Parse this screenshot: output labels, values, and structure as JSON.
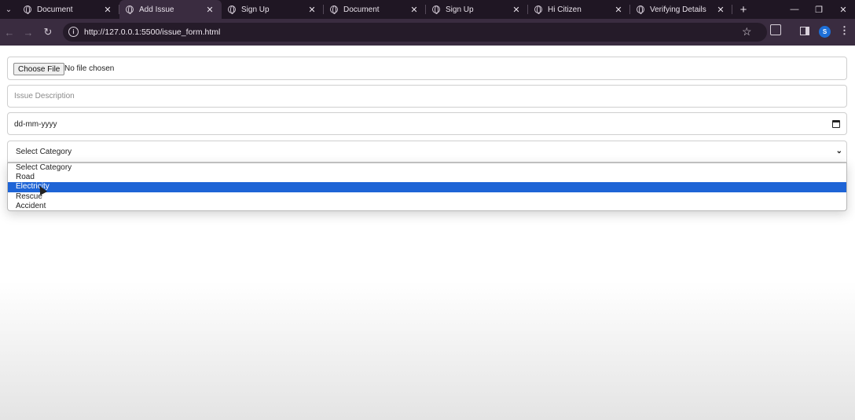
{
  "browser": {
    "tabs": [
      {
        "title": "Document",
        "active": false
      },
      {
        "title": "Add Issue",
        "active": true
      },
      {
        "title": "Sign Up",
        "active": false
      },
      {
        "title": "Document",
        "active": false
      },
      {
        "title": "Sign Up",
        "active": false
      },
      {
        "title": "Hi Citizen",
        "active": false
      },
      {
        "title": "Verifying Details",
        "active": false
      }
    ],
    "url": "http://127.0.0.1:5500/issue_form.html",
    "profile_initial": "S"
  },
  "form": {
    "file_button_label": "Choose File",
    "file_status": "No file chosen",
    "description_placeholder": "Issue Description",
    "date_placeholder": "dd-mm-yyyy",
    "category_selected": "Select Category",
    "category_options": [
      "Select Category",
      "Road",
      "Electricity",
      "Rescue",
      "Accident"
    ],
    "highlighted_option": "Electricity"
  },
  "colors": {
    "tabbar": "#1f1623",
    "toolbar": "#3a2c40",
    "highlight": "#1e64d6"
  }
}
